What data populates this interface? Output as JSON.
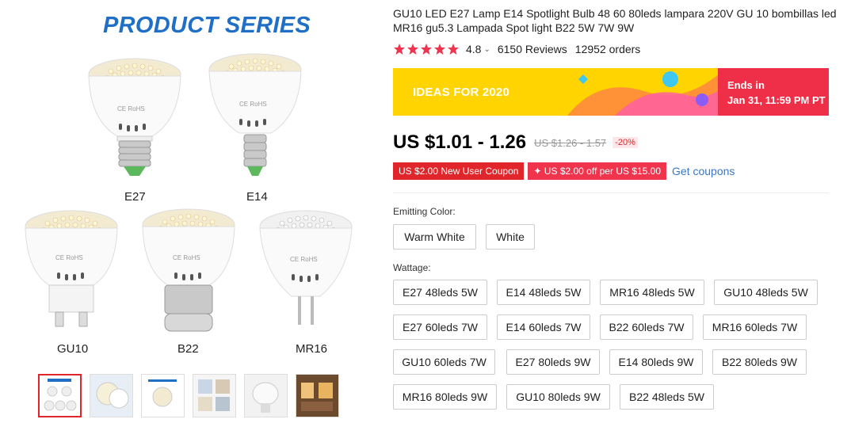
{
  "gallery": {
    "series_title": "PRODUCT SERIES",
    "bulbs": [
      "E27",
      "E14",
      "GU10",
      "B22",
      "MR16"
    ],
    "thumbnail_count": 6,
    "active_thumbnail": 0
  },
  "product": {
    "title": "GU10 LED E27 Lamp E14 Spotlight Bulb 48 60 80leds lampara 220V GU 10 bombillas led MR16 gu5.3 Lampada Spot light B22 5W 7W 9W",
    "rating": "4.8",
    "rating_stars": 5,
    "reviews": "6150 Reviews",
    "orders": "12952 orders"
  },
  "promo": {
    "banner_text": "IDEAS FOR 2020",
    "ends_label": "Ends in",
    "ends_time": "Jan 31, 11:59 PM PT",
    "colors": {
      "banner": "#ffd400",
      "end_box": "#ef2f48"
    }
  },
  "pricing": {
    "price": "US $1.01 - 1.26",
    "original_price": "US $1.26 - 1.57",
    "discount": "-20%"
  },
  "coupons": {
    "new_user": "US $2.00 New User Coupon",
    "store": "✦ US $2.00 off per US $15.00",
    "get_link": "Get coupons"
  },
  "emitting_color": {
    "label": "Emitting Color:",
    "options": [
      "Warm White",
      "White"
    ]
  },
  "wattage": {
    "label": "Wattage:",
    "options": [
      "E27 48leds 5W",
      "E14 48leds 5W",
      "MR16 48leds 5W",
      "GU10 48leds 5W",
      "E27 60leds 7W",
      "E14 60leds 7W",
      "B22 60leds 7W",
      "MR16 60leds 7W",
      "GU10 60leds 7W",
      "E27 80leds 9W",
      "E14 80leds 9W",
      "B22 80leds 9W",
      "MR16 80leds 9W",
      "GU10 80leds 9W",
      "B22 48leds 5W"
    ]
  }
}
